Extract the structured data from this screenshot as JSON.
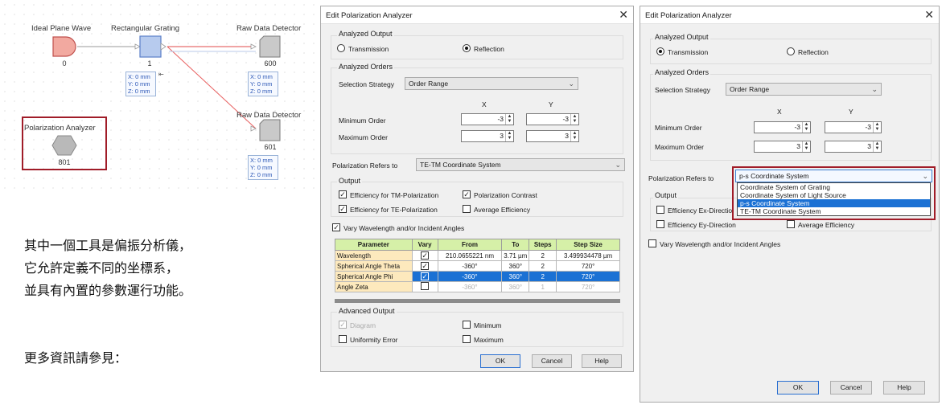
{
  "canvas": {
    "nodes": {
      "ideal_plane_wave": {
        "title": "Ideal Plane Wave",
        "id": "0"
      },
      "rect_grating": {
        "title": "Rectangular Grating",
        "id": "1",
        "coords": [
          "X: 0 mm",
          "Y: 0 mm",
          "Z: 0 mm"
        ]
      },
      "raw_detector_1": {
        "title": "Raw Data Detector",
        "id": "600",
        "coords": [
          "X: 0 mm",
          "Y: 0 mm",
          "Z: 0 mm"
        ]
      },
      "raw_detector_2": {
        "title": "Raw Data Detector",
        "id": "601",
        "coords": [
          "X: 0 mm",
          "Y: 0 mm",
          "Z: 0 mm"
        ]
      },
      "polarization_analyzer": {
        "title": "Polarization Analyzer",
        "id": "801"
      }
    }
  },
  "caption": {
    "line1": "其中一個工具是偏振分析儀，",
    "line2": "它允許定義不同的坐標系，",
    "line3": "並具有內置的參數運行功能。",
    "more": "更多資訊請參見："
  },
  "dialog1": {
    "title": "Edit Polarization Analyzer",
    "close": "✕",
    "analyzed_output": {
      "label": "Analyzed Output",
      "transmission": "Transmission",
      "reflection": "Reflection",
      "selected": "Reflection"
    },
    "analyzed_orders": {
      "label": "Analyzed Orders",
      "strategy_label": "Selection Strategy",
      "strategy_value": "Order Range",
      "x": "X",
      "y": "Y",
      "min_label": "Minimum Order",
      "min_x": "-3",
      "min_y": "-3",
      "max_label": "Maximum Order",
      "max_x": "3",
      "max_y": "3"
    },
    "refers_label": "Polarization Refers to",
    "refers_value": "TE-TM Coordinate System",
    "output": {
      "label": "Output",
      "eff_tm": "Efficiency for TM-Polarization",
      "pol_contrast": "Polarization Contrast",
      "eff_te": "Efficiency for TE-Polarization",
      "avg_eff": "Average Efficiency"
    },
    "vary_label": "Vary Wavelength and/or Incident Angles",
    "table": {
      "headers": [
        "Parameter",
        "Vary",
        "From",
        "To",
        "Steps",
        "Step Size"
      ],
      "rows": [
        {
          "param": "Wavelength",
          "from": "210.0655221 nm",
          "to": "3.71 µm",
          "steps": "2",
          "step_size": "3.499934478 µm"
        },
        {
          "param": "Spherical Angle Theta",
          "from": "-360°",
          "to": "360°",
          "steps": "2",
          "step_size": "720°"
        },
        {
          "param": "Spherical Angle Phi",
          "from": "-360°",
          "to": "360°",
          "steps": "2",
          "step_size": "720°"
        },
        {
          "param": "Angle Zeta",
          "from": "-360°",
          "to": "360°",
          "steps": "1",
          "step_size": "720°"
        }
      ]
    },
    "advanced": {
      "label": "Advanced Output",
      "diagram": "Diagram",
      "minimum": "Minimum",
      "uniformity": "Uniformity Error",
      "maximum": "Maximum"
    },
    "buttons": {
      "ok": "OK",
      "cancel": "Cancel",
      "help": "Help"
    }
  },
  "dialog2": {
    "title": "Edit Polarization Analyzer",
    "close": "✕",
    "analyzed_output": {
      "label": "Analyzed Output",
      "transmission": "Transmission",
      "reflection": "Reflection",
      "selected": "Transmission"
    },
    "analyzed_orders": {
      "label": "Analyzed Orders",
      "strategy_label": "Selection Strategy",
      "strategy_value": "Order Range",
      "x": "X",
      "y": "Y",
      "min_label": "Minimum Order",
      "min_x": "-3",
      "min_y": "-3",
      "max_label": "Maximum Order",
      "max_x": "3",
      "max_y": "3"
    },
    "refers_label": "Polarization Refers to",
    "refers_value": "p-s Coordinate System",
    "dropdown_options": [
      "Coordinate System of Grating",
      "Coordinate System of Light Source",
      "p-s Coordinate System",
      "TE-TM Coordinate System"
    ],
    "output": {
      "label": "Output",
      "eff_ex": "Efficiency Ex-Directio",
      "eff_ey": "Efficiency Ey-Direction",
      "avg_eff": "Average Efficiency"
    },
    "vary_label": "Vary Wavelength and/or Incident Angles",
    "buttons": {
      "ok": "OK",
      "cancel": "Cancel",
      "help": "Help"
    }
  },
  "colors": {
    "accent": "#1b71d4",
    "highlight_frame": "#a01c28",
    "table_header": "#d6f0a8",
    "param_cell": "#fde9bd"
  }
}
